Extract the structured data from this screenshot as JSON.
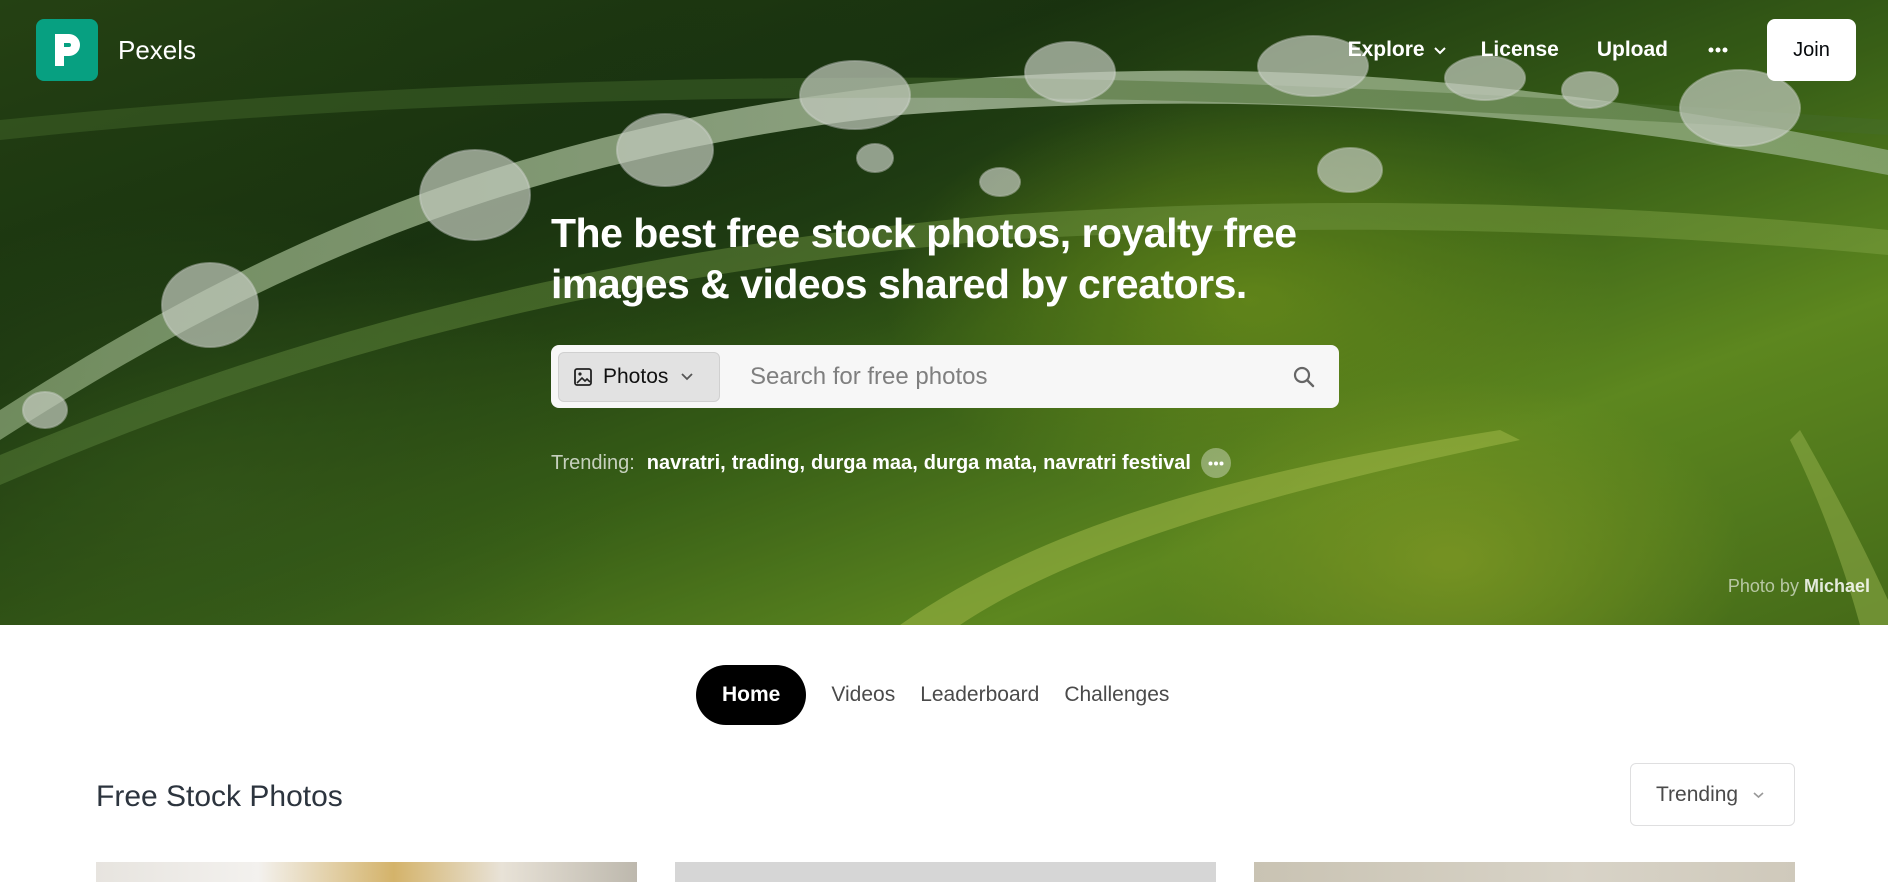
{
  "brand": {
    "name": "Pexels",
    "accent": "#07a081"
  },
  "nav": {
    "explore": "Explore",
    "license": "License",
    "upload": "Upload",
    "more_icon": "ellipsis-icon",
    "join": "Join"
  },
  "hero": {
    "headline": "The best free stock photos, royalty free images & videos shared by creators.",
    "search": {
      "type": "Photos",
      "placeholder": "Search for free photos"
    },
    "trending": {
      "label": "Trending:",
      "terms": [
        "navratri",
        "trading",
        "durga maa",
        "durga mata",
        "navratri festival"
      ]
    },
    "credit": {
      "prefix": "Photo by",
      "author": "Michael"
    }
  },
  "tabs": [
    "Home",
    "Videos",
    "Leaderboard",
    "Challenges"
  ],
  "section": {
    "title": "Free Stock Photos",
    "sort": "Trending"
  }
}
